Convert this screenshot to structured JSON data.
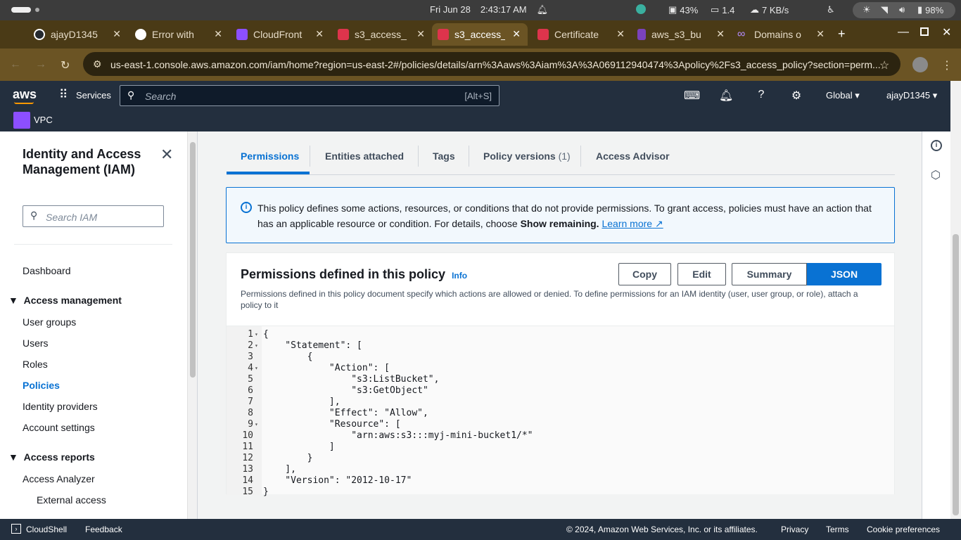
{
  "os": {
    "date": "Fri Jun 28",
    "time": "2:43:17 AM",
    "cpu": "43%",
    "load": "1.4",
    "net": "7 KB/s",
    "battery": "98%"
  },
  "browser": {
    "tabs": [
      {
        "title": "ajayD1345",
        "color": "#24292f"
      },
      {
        "title": "Error with",
        "color": "#555"
      },
      {
        "title": "CloudFront",
        "color": "#8c4fff"
      },
      {
        "title": "s3_access_",
        "color": "#dd344c"
      },
      {
        "title": "s3_access_",
        "color": "#dd344c"
      },
      {
        "title": "Certificate",
        "color": "#dd344c"
      },
      {
        "title": "aws_s3_bu",
        "color": "#7b42bc"
      },
      {
        "title": "Domains o",
        "color": "#9146ff"
      }
    ],
    "url": "us-east-1.console.aws.amazon.com/iam/home?region=us-east-2#/policies/details/arn%3Aaws%3Aiam%3A%3A069112940474%3Apolicy%2Fs3_access_policy?section=perm..."
  },
  "aws": {
    "logo": "aws",
    "services": "Services",
    "search_placeholder": "Search",
    "search_shortcut": "[Alt+S]",
    "region": "Global",
    "account": "ajayD1345",
    "fav_service": "VPC"
  },
  "sidebar": {
    "title": "Identity and Access Management (IAM)",
    "search_placeholder": "Search IAM",
    "dashboard": "Dashboard",
    "access_mgmt": "Access management",
    "items": [
      "User groups",
      "Users",
      "Roles",
      "Policies",
      "Identity providers",
      "Account settings"
    ],
    "access_reports": "Access reports",
    "report_items": [
      "Access Analyzer",
      "External access"
    ]
  },
  "tabs_main": {
    "permissions": "Permissions",
    "entities": "Entities attached",
    "tags": "Tags",
    "versions": "Policy versions",
    "versions_count": "(1)",
    "advisor": "Access Advisor"
  },
  "info": {
    "text": "This policy defines some actions, resources, or conditions that do not provide permissions. To grant access, policies must have an action that has an applicable resource or condition. For details, choose ",
    "bold": "Show remaining.",
    "link": "Learn more"
  },
  "panel": {
    "title": "Permissions defined in this policy",
    "info_link": "Info",
    "copy": "Copy",
    "edit": "Edit",
    "summary": "Summary",
    "json": "JSON",
    "desc": "Permissions defined in this policy document specify which actions are allowed or denied. To define permissions for an IAM identity (user, user group, or role), attach a policy to it"
  },
  "code_lines": [
    "{",
    "    \"Statement\": [",
    "        {",
    "            \"Action\": [",
    "                \"s3:ListBucket\",",
    "                \"s3:GetObject\"",
    "            ],",
    "            \"Effect\": \"Allow\",",
    "            \"Resource\": [",
    "                \"arn:aws:s3:::myj-mini-bucket1/*\"",
    "            ]",
    "        }",
    "    ],",
    "    \"Version\": \"2012-10-17\"",
    "}"
  ],
  "footer": {
    "cloudshell": "CloudShell",
    "feedback": "Feedback",
    "copyright": "© 2024, Amazon Web Services, Inc. or its affiliates.",
    "privacy": "Privacy",
    "terms": "Terms",
    "cookies": "Cookie preferences"
  }
}
